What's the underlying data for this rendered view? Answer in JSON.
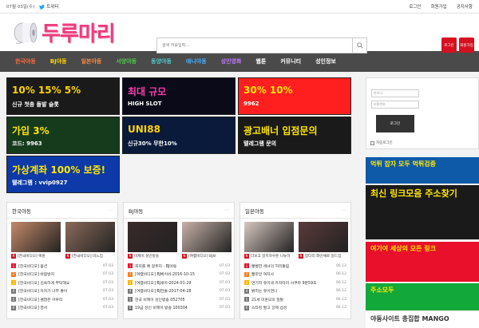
{
  "topbar": {
    "date": "07월 03일(수)",
    "twitter_label": "트위터",
    "links": [
      "로그인",
      "회원가입",
      "공지사항"
    ]
  },
  "header": {
    "logo_text": "두루마리",
    "search_placeholder": "검색 어를입력...",
    "buttons": [
      "로그인",
      "회원가입"
    ]
  },
  "nav": {
    "items": [
      {
        "label": "한국야동",
        "color": "#ff6a3d"
      },
      {
        "label": "BJ야동",
        "color": "#ffd400"
      },
      {
        "label": "일본야동",
        "color": "#ff8a3d"
      },
      {
        "label": "서양야동",
        "color": "#4ecb4e"
      },
      {
        "label": "동양야동",
        "color": "#4ecbcb"
      },
      {
        "label": "애니야동",
        "color": "#46b0ff"
      },
      {
        "label": "성인영화",
        "color": "#c37bff"
      },
      {
        "label": "웹툰",
        "color": "#ffffff"
      },
      {
        "label": "커뮤니티",
        "color": "#ffffff"
      },
      {
        "label": "성인정보",
        "color": "#ffffff"
      }
    ]
  },
  "banners": [
    {
      "line1": "10% 15% 5%",
      "line2": "신규 첫충 돌발 슬롯",
      "bg": "#1a1a1a",
      "fg": "#ffd400"
    },
    {
      "line1": "최대 규모",
      "line2": "HIGH SLOT",
      "bg": "#0a0a18",
      "fg": "#ff3ab0"
    },
    {
      "line1": "30% 10%",
      "line2": "9962",
      "bg": "#ff1f1f",
      "fg": "#ffe600"
    },
    {
      "line1": "가입 3%",
      "line2": "코드: 9963",
      "bg": "#163a1c",
      "fg": "#ffe600"
    },
    {
      "line1": "UNI88",
      "line2": "신규30% 무한10%",
      "bg": "#0a1a3a",
      "fg": "#ffd400"
    },
    {
      "line1": "광고배너 입점문의",
      "line2": "텔레그램 문의",
      "bg": "#1a1a1a",
      "fg": "#ffe600"
    },
    {
      "line1": "가상계좌 100% 보증!",
      "line2": "텔레그램 : vvip0927",
      "bg": "#0d3aa8",
      "fg": "#ffe600"
    }
  ],
  "side_banners": [
    {
      "text": "먹튀 잡자 모두 먹튀검증",
      "bg": "#0f5aa8"
    },
    {
      "text": "최신 링크모음 주소찾기",
      "bg": "#1a1a1a"
    },
    {
      "text": "여기여 세상의 모든 링크",
      "bg": "#e8102a"
    },
    {
      "text": "주소모두",
      "bg": "#13a83a"
    },
    {
      "text": "야동사이트 총집합 MANGO",
      "bg": "#fff"
    }
  ],
  "login": {
    "id_placeholder": "아이디",
    "pw_placeholder": "비밀번호",
    "button": "로그인",
    "remember": "자동로그인"
  },
  "panels": [
    {
      "title": "한국야동",
      "thumbs": [
        {
          "caption": "[한국비디오] 애원",
          "color": "#c48a6a"
        },
        {
          "caption": "[한국비디오] 미느집",
          "color": "#8a6a5a"
        }
      ],
      "rows": [
        {
          "text": "[한국비디오] 옵션",
          "date": "07.03"
        },
        {
          "text": "[한국비디오] 바람방지",
          "date": "07.03"
        },
        {
          "text": "[한국비디오] 김숙하게 부탁해요",
          "date": "07.03"
        },
        {
          "text": "[한국비디오] 자지가 너무 좋아",
          "date": "07.03"
        },
        {
          "text": "[한국비디오] 괜찮은 아우리",
          "date": "07.03"
        },
        {
          "text": "[한국비디오] 영서",
          "date": "07.03"
        }
      ]
    },
    {
      "title": "BJ야동",
      "thumbs": [
        {
          "caption": "비제이 성인방송",
          "color": "#3a2a2a"
        },
        {
          "caption": "[여캠비디오] BJ보",
          "color": "#c8b2a8"
        }
      ],
      "rows": [
        {
          "text": "꼭지를 배 갈주지 - BJ야동",
          "date": "07.03"
        },
        {
          "text": "[여캠비디오] BJ베이비-2016-10-15",
          "date": "07.03"
        },
        {
          "text": "[여캠비디오] BJ새아-2024-01-29",
          "date": "07.03"
        },
        {
          "text": "[여캠비디오] BJ한울-2017-04-28",
          "date": "07.03"
        },
        {
          "text": "한국 비제이 성인방송 052705",
          "date": "07.03"
        },
        {
          "text": "19금 성인 비제이 방송 100304",
          "date": "07.03"
        }
      ]
    },
    {
      "title": "일본야동",
      "thumbs": [
        {
          "caption": "다보고 일치하우준 니뉴허",
          "color": "#d8c8c0"
        },
        {
          "caption": "팜다리 화인채로 일드집",
          "color": "#5a3a3a"
        }
      ],
      "rows": [
        {
          "text": "뻥뻥한 색녀의 허리돌림",
          "date": "06.12"
        },
        {
          "text": "빨갛던 여자사",
          "date": "06.12"
        },
        {
          "text": "연기파 유이네 카지타미 사쿠라 9분59초",
          "date": "06.12"
        },
        {
          "text": "밝히는 유이연니",
          "date": "06.12"
        },
        {
          "text": "21세 미혼모의 일탈",
          "date": "06.12"
        },
        {
          "text": "스타킹 발고 강제 섭성",
          "date": "06.12"
        }
      ]
    }
  ],
  "colors": {
    "accent": "#d6101f",
    "nav_bg": "#4a4a4a",
    "num_colors": [
      "#e8102a",
      "#ff7a1a",
      "#ffb400",
      "#777777",
      "#777777",
      "#777777"
    ]
  }
}
